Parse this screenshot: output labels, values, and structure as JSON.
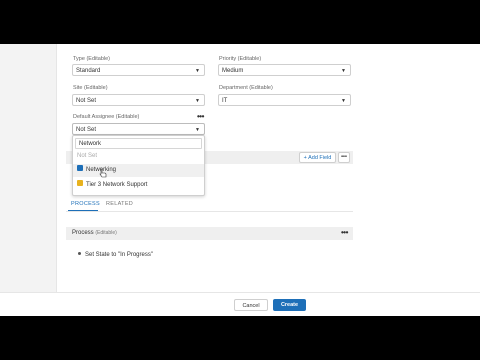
{
  "form": {
    "type": {
      "label": "Type (Editable)",
      "value": "Standard"
    },
    "priority": {
      "label": "Priority (Editable)",
      "value": "Medium"
    },
    "site": {
      "label": "Site (Editable)",
      "value": "Not Set"
    },
    "department": {
      "label": "Department (Editable)",
      "value": "IT"
    },
    "default_assignee": {
      "label": "Default Assignee (Editable)",
      "value": "Not Set"
    }
  },
  "dropdown": {
    "search_value": "Network",
    "items": [
      {
        "label": "Not Set"
      },
      {
        "label": "Networking",
        "icon": "group-icon",
        "color": "#1d6fb8"
      },
      {
        "label": "Tier 3 Network Support",
        "icon": "group-icon",
        "color": "#e8b21e"
      }
    ]
  },
  "fields_bar": {
    "add_field_label": "+ Add Field"
  },
  "tabs": [
    {
      "label": "PROCESS"
    },
    {
      "label": "RELATED"
    }
  ],
  "process": {
    "title": "Process",
    "title_note": "(Editable)",
    "step": "Set State to \"In Progress\""
  },
  "footer": {
    "cancel_label": "Cancel",
    "create_label": "Create"
  },
  "colors": {
    "primary": "#1d6fb8",
    "tab_active": "#1d6fb8"
  }
}
